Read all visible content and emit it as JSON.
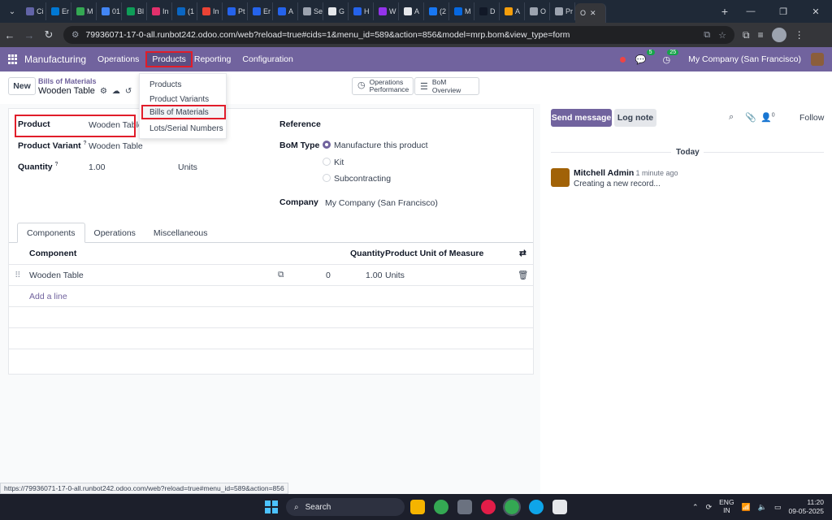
{
  "browser": {
    "tabs": [
      {
        "label": "Ci",
        "color": "#6264a7"
      },
      {
        "label": "Er",
        "color": "#0078d4"
      },
      {
        "label": "M",
        "color": "#34a853"
      },
      {
        "label": "01",
        "color": "#4285f4"
      },
      {
        "label": "Bl",
        "color": "#0f9d58"
      },
      {
        "label": "In",
        "color": "#e1306c"
      },
      {
        "label": "(1",
        "color": "#0a66c2"
      },
      {
        "label": "In",
        "color": "#ea4335"
      },
      {
        "label": "Pt",
        "color": "#2563eb"
      },
      {
        "label": "Er",
        "color": "#2563eb"
      },
      {
        "label": "A",
        "color": "#2563eb"
      },
      {
        "label": "Se",
        "color": "#9ca3af"
      },
      {
        "label": "G",
        "color": "#e5e7eb"
      },
      {
        "label": "H",
        "color": "#2563eb"
      },
      {
        "label": "W",
        "color": "#9333ea"
      },
      {
        "label": "A",
        "color": "#e5e7eb"
      },
      {
        "label": "(2",
        "color": "#1877f2"
      },
      {
        "label": "M",
        "color": "#0668e1"
      },
      {
        "label": "D",
        "color": "#111827"
      },
      {
        "label": "A",
        "color": "#f59e0b"
      },
      {
        "label": "O",
        "color": "#9ca3af"
      },
      {
        "label": "Pr",
        "color": "#9ca3af"
      }
    ],
    "active_tab": {
      "label": "O"
    },
    "new_tab": "+",
    "url": "79936071-17-0-all.runbot242.odoo.com/web?reload=true#cids=1&menu_id=589&action=856&model=mrp.bom&view_type=form"
  },
  "navbar": {
    "app_name": "Manufacturing",
    "menu": {
      "operations": "Operations",
      "products": "Products",
      "reporting": "Reporting",
      "configuration": "Configuration"
    },
    "messages_count": "5",
    "activities_count": "25",
    "company": "My Company (San Francisco)"
  },
  "control": {
    "new_label": "New",
    "breadcrumb_parent": "Bills of Materials",
    "breadcrumb_current": "Wooden Table",
    "smart_ops": [
      "Operations",
      "Performance"
    ],
    "smart_bom": "BoM Overview"
  },
  "dropdown": {
    "items": [
      "Products",
      "Product Variants",
      "Bills of Materials",
      "Lots/Serial Numbers"
    ]
  },
  "form": {
    "product_label": "Product",
    "product_value": "Wooden Table",
    "variant_label": "Product Variant",
    "variant_value": "Wooden Table",
    "quantity_label": "Quantity",
    "quantity_value": "1.00",
    "quantity_unit": "Units",
    "help_mark": "?",
    "reference_label": "Reference",
    "bom_type_label": "BoM Type",
    "bom_type_options": [
      "Manufacture this product",
      "Kit",
      "Subcontracting"
    ],
    "company_label": "Company",
    "company_value": "My Company (San Francisco)"
  },
  "notebook": {
    "tabs": [
      "Components",
      "Operations",
      "Miscellaneous"
    ]
  },
  "components_table": {
    "headers": {
      "component": "Component",
      "quantity": "Quantity",
      "uom": "Product Unit of Measure"
    },
    "row": {
      "component": "Wooden Table",
      "zero": "0",
      "quantity": "1.00",
      "uom": "Units"
    },
    "add_line": "Add a line"
  },
  "chatter": {
    "send_message": "Send message",
    "log_note": "Log note",
    "attachments_count": "0",
    "follow": "Follow",
    "today": "Today",
    "author": "Mitchell Admin",
    "time": "- 1 minute ago",
    "body": "Creating a new record..."
  },
  "status_link": "https://79936071-17-0-all.runbot242.odoo.com/web?reload=true#menu_id=589&action=856",
  "taskbar": {
    "search_label": "Search",
    "lang_line1": "ENG",
    "lang_line2": "IN",
    "time": "11:20",
    "date": "09-05-2025"
  }
}
